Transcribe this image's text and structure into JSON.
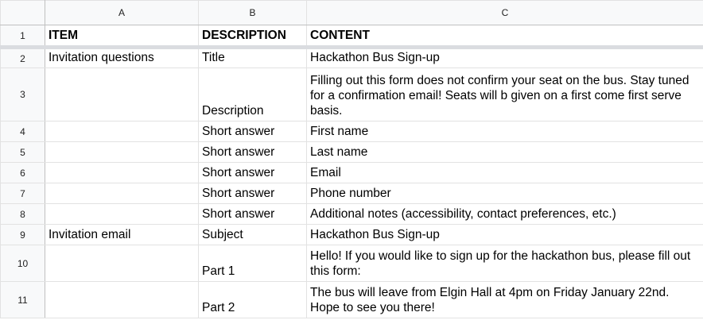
{
  "columns": [
    "A",
    "B",
    "C"
  ],
  "rows": [
    {
      "num": "1",
      "a": "ITEM",
      "b": "DESCRIPTION",
      "c": "CONTENT"
    },
    {
      "num": "2",
      "a": "Invitation questions",
      "b": "Title",
      "c": "Hackathon Bus Sign-up"
    },
    {
      "num": "3",
      "a": "",
      "b": "Description",
      "c": "Filling out this form does not confirm your seat on the bus. Stay tuned for a confirmation email! Seats will b given on a first come first serve basis."
    },
    {
      "num": "4",
      "a": "",
      "b": "Short answer",
      "c": "First name"
    },
    {
      "num": "5",
      "a": "",
      "b": "Short answer",
      "c": "Last name"
    },
    {
      "num": "6",
      "a": "",
      "b": "Short answer",
      "c": "Email"
    },
    {
      "num": "7",
      "a": "",
      "b": "Short answer",
      "c": "Phone number"
    },
    {
      "num": "8",
      "a": "",
      "b": "Short answer",
      "c": "Additional notes (accessibility, contact preferences, etc.)"
    },
    {
      "num": "9",
      "a": "Invitation email",
      "b": "Subject",
      "c": "Hackathon Bus Sign-up"
    },
    {
      "num": "10",
      "a": "",
      "b": "Part 1",
      "c": "Hello! If you would like to sign up for the hackathon bus, please fill out this form:"
    },
    {
      "num": "11",
      "a": "",
      "b": "Part 2",
      "c": "The bus will leave from Elgin Hall at 4pm on Friday January 22nd. Hope to see you there!"
    }
  ]
}
